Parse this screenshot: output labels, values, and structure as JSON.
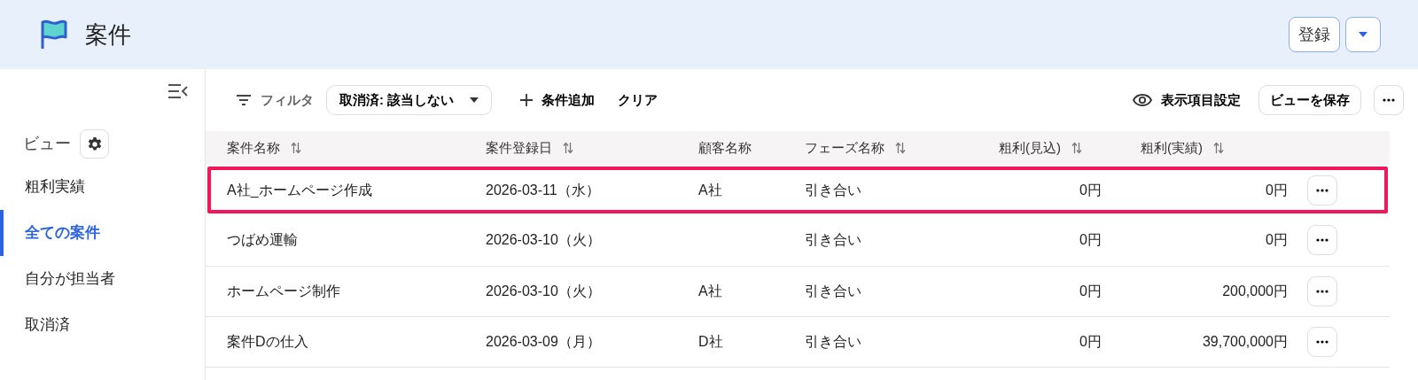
{
  "header": {
    "title": "案件",
    "register_button": "登録"
  },
  "sidebar": {
    "views_label": "ビュー",
    "items": [
      {
        "label": "粗利実績",
        "selected": false
      },
      {
        "label": "全ての案件",
        "selected": true
      },
      {
        "label": "自分が担当者",
        "selected": false
      },
      {
        "label": "取消済",
        "selected": false
      }
    ]
  },
  "toolbar": {
    "filter_label": "フィルタ",
    "filter_chip": "取消済: 該当しない",
    "add_condition": "条件追加",
    "clear": "クリア",
    "display_settings": "表示項目設定",
    "save_view": "ビューを保存"
  },
  "table": {
    "columns": [
      {
        "label": "案件名称",
        "sortable": true,
        "kind": "text"
      },
      {
        "label": "案件登録日",
        "sortable": true,
        "kind": "text"
      },
      {
        "label": "顧客名称",
        "sortable": false,
        "kind": "text"
      },
      {
        "label": "フェーズ名称",
        "sortable": true,
        "kind": "text"
      },
      {
        "label": "粗利(見込)",
        "sortable": true,
        "kind": "amount"
      },
      {
        "label": "粗利(実績)",
        "sortable": true,
        "kind": "amount"
      }
    ],
    "rows": [
      {
        "cells": [
          "A社_ホームページ作成",
          "2026-03-11（水）",
          "A社",
          "引き合い",
          "0円",
          "0円"
        ],
        "highlighted": true
      },
      {
        "cells": [
          "つばめ運輸",
          "2026-03-10（火）",
          "",
          "引き合い",
          "0円",
          "0円"
        ],
        "highlighted": false
      },
      {
        "cells": [
          "ホームページ制作",
          "2026-03-10（火）",
          "A社",
          "引き合い",
          "0円",
          "200,000円"
        ],
        "highlighted": false
      },
      {
        "cells": [
          "案件Dの仕入",
          "2026-03-09（月）",
          "D社",
          "引き合い",
          "0円",
          "39,700,000円"
        ],
        "highlighted": false
      }
    ]
  }
}
